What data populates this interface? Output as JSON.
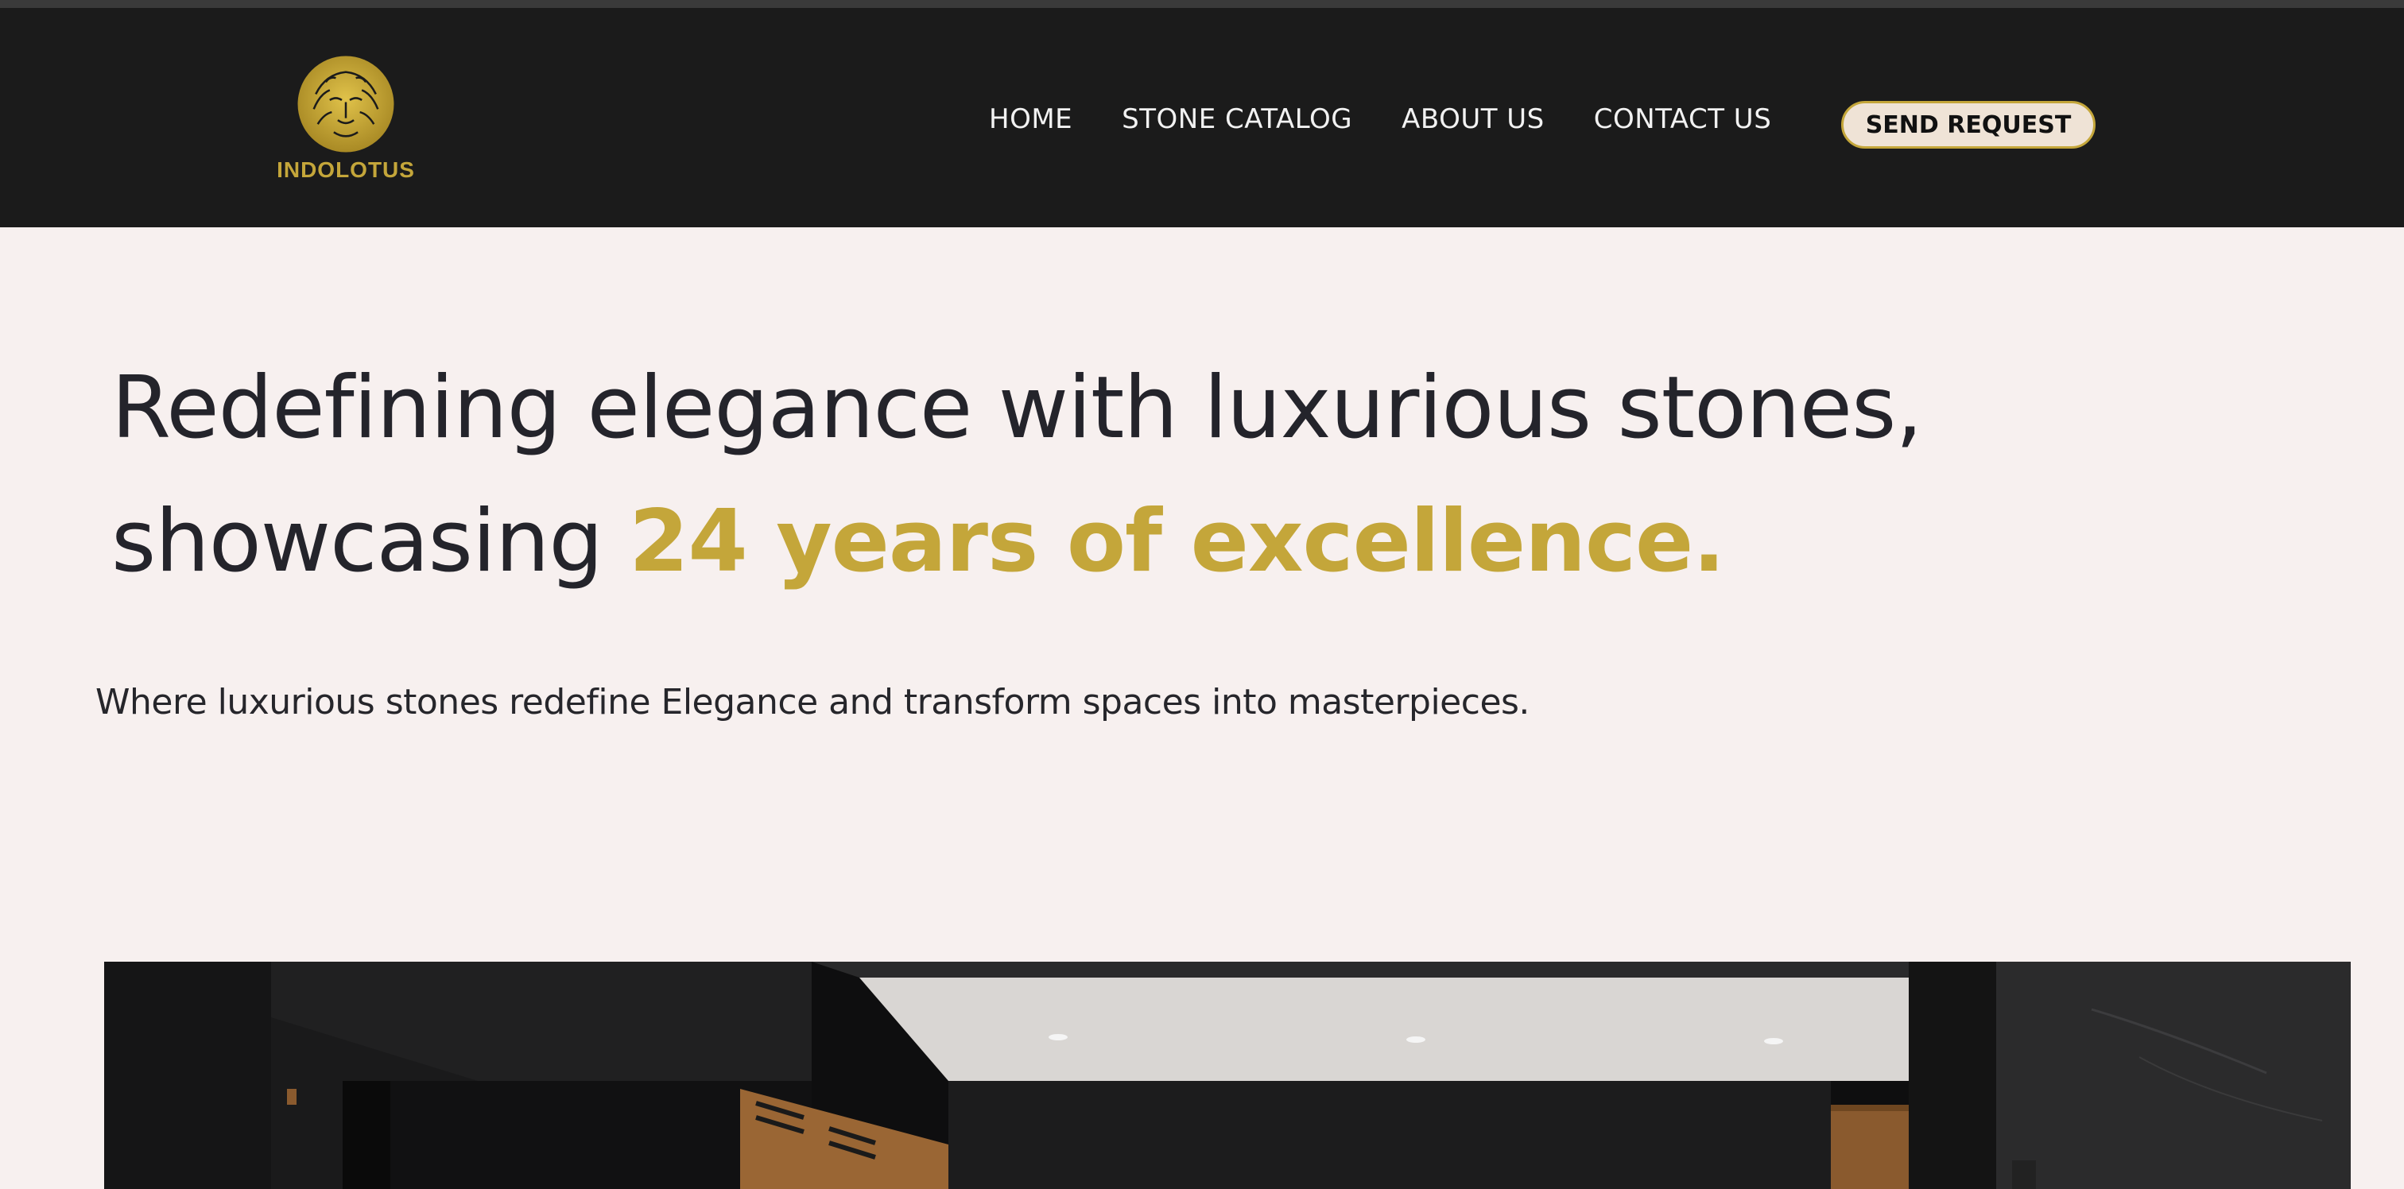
{
  "brand": {
    "name": "INDOLOTUS",
    "logo_icon": "lion-head-icon",
    "accent_color": "#c4a63a",
    "header_bg": "#1b1b1b",
    "page_bg": "#f7f0ef"
  },
  "nav": {
    "items": [
      {
        "label": "HOME"
      },
      {
        "label": "STONE CATALOG"
      },
      {
        "label": "ABOUT US"
      },
      {
        "label": "CONTACT US"
      }
    ],
    "cta_label": "SEND REQUEST"
  },
  "hero": {
    "title_line1": "Redefining elegance with luxurious stones,",
    "title_line2_prefix": "showcasing ",
    "title_line2_accent": "24 years of excellence.",
    "subtitle": "Where luxurious stones redefine Elegance and transform spaces into masterpieces."
  }
}
